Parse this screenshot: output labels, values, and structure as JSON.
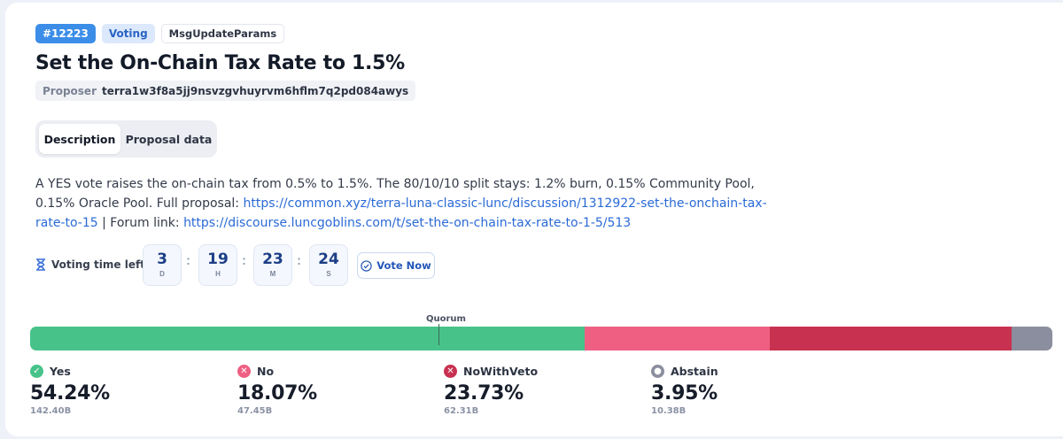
{
  "tags": {
    "id": "#12223",
    "status": "Voting",
    "type": "MsgUpdateParams"
  },
  "title": "Set the On-Chain Tax Rate to 1.5%",
  "proposer": {
    "label": "Proposer",
    "address": "terra1w3f8a5jj9nsvzgvhuyrvm6hflm7q2pd084awys"
  },
  "tabs": [
    {
      "label": "Description",
      "active": true
    },
    {
      "label": "Proposal data",
      "active": false
    }
  ],
  "description": {
    "text1": "A YES vote raises the on-chain tax from 0.5% to 1.5%. The 80/10/10 split stays: 1.2% burn, 0.15% Community Pool, 0.15% Oracle Pool. Full proposal: ",
    "link1": "https://common.xyz/terra-luna-classic-lunc/discussion/1312922-set-the-onchain-tax-rate-to-15",
    "text2": " | Forum link: ",
    "link2": "https://discourse.luncgoblins.com/t/set-the-on-chain-tax-rate-to-1-5/513"
  },
  "timer": {
    "label": "Voting time left",
    "icon": "hourglass-icon",
    "days": "3",
    "days_unit": "D",
    "hours": "19",
    "hours_unit": "H",
    "minutes": "23",
    "minutes_unit": "M",
    "seconds": "24",
    "seconds_unit": "S"
  },
  "vote_button": {
    "label": "Vote Now",
    "icon": "check-circle-icon"
  },
  "quorum": {
    "label": "Quorum"
  },
  "tally": [
    {
      "key": "yes",
      "label": "Yes",
      "percent": "54.24%",
      "amount": "142.40B",
      "share": 54.24,
      "color": "#47c389",
      "icon": "check-icon",
      "glyph": "✓"
    },
    {
      "key": "no",
      "label": "No",
      "percent": "18.07%",
      "amount": "47.45B",
      "share": 18.07,
      "color": "#ee5f82",
      "icon": "x-icon",
      "glyph": "✕"
    },
    {
      "key": "nowithveto",
      "label": "NoWithVeto",
      "percent": "23.73%",
      "amount": "62.31B",
      "share": 23.73,
      "color": "#c83150",
      "icon": "x-icon",
      "glyph": "✕"
    },
    {
      "key": "abstain",
      "label": "Abstain",
      "percent": "3.95%",
      "amount": "10.38B",
      "share": 3.95,
      "color": "#8b8e9e",
      "icon": "dot-icon",
      "glyph": "●"
    }
  ],
  "colors": {
    "accent": "#3b8de8",
    "link": "#2a6ad6"
  }
}
